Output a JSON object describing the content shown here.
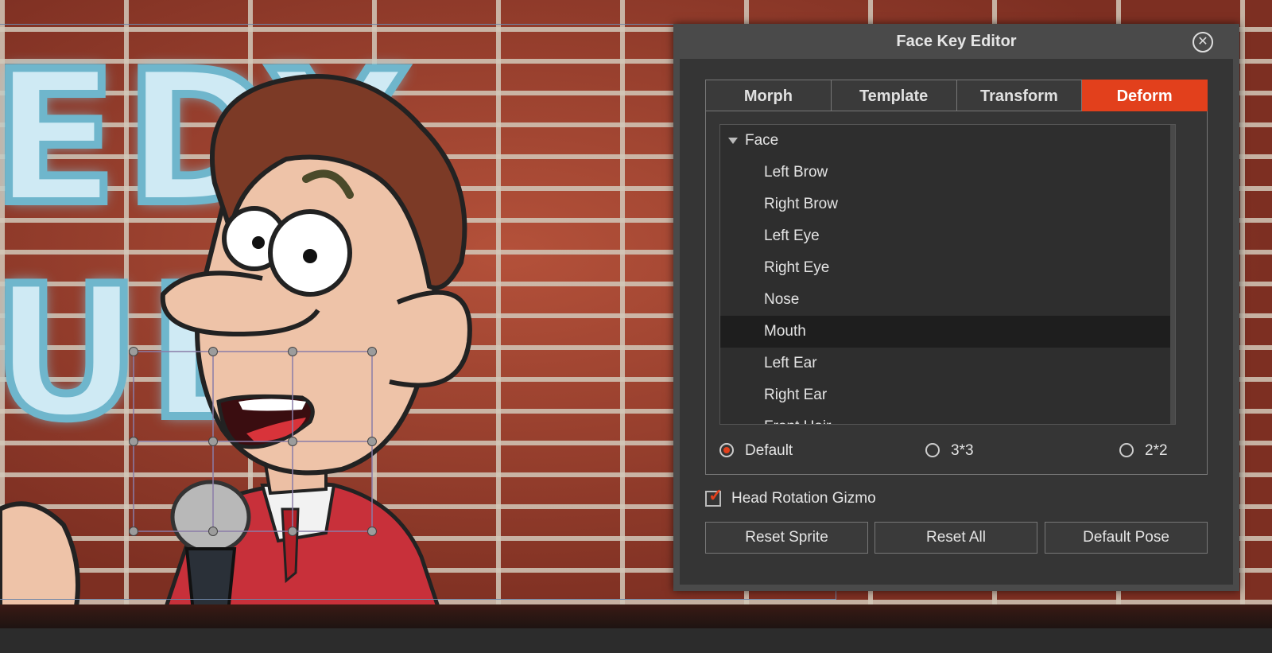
{
  "dialog": {
    "title": "Face Key Editor",
    "close_icon": "close-circle-icon"
  },
  "tabs": [
    {
      "label": "Morph",
      "active": false
    },
    {
      "label": "Template",
      "active": false
    },
    {
      "label": "Transform",
      "active": false
    },
    {
      "label": "Deform",
      "active": true
    }
  ],
  "tree": {
    "parent": "Face",
    "items": [
      "Left Brow",
      "Right Brow",
      "Left Eye",
      "Right Eye",
      "Nose",
      "Mouth",
      "Left Ear",
      "Right Ear",
      "Front Hair"
    ],
    "selected": "Mouth"
  },
  "grid_options": {
    "selected": "Default",
    "options": [
      "Default",
      "3*3",
      "2*2"
    ]
  },
  "head_rotation_gizmo": {
    "label": "Head Rotation Gizmo",
    "checked": true
  },
  "buttons": {
    "reset_sprite": "Reset Sprite",
    "reset_all": "Reset All",
    "default_pose": "Default Pose"
  },
  "scene": {
    "sign_text": "EDY\nUB"
  },
  "colors": {
    "accent": "#e2401c",
    "panel": "#353535",
    "title_bar": "#4a4a4a"
  }
}
